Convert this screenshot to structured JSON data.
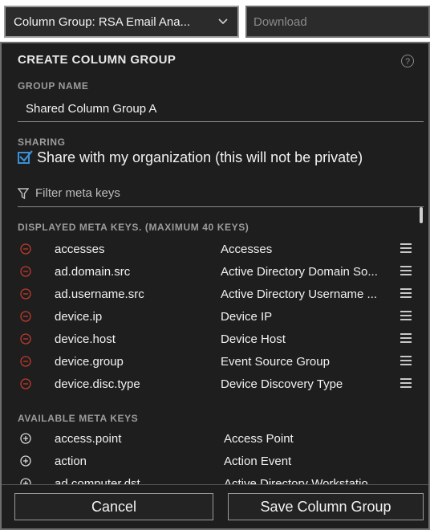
{
  "topbar": {
    "column_group_label": "Column Group: RSA Email Ana...",
    "download_placeholder": "Download"
  },
  "panel": {
    "title": "CREATE COLUMN GROUP",
    "help_icon": "question-circle-icon",
    "group_name_label": "GROUP NAME",
    "group_name_value": "Shared Column Group A",
    "sharing_label": "SHARING",
    "share_checkbox_label": "Share with my organization (this will not be private)",
    "share_checked": true,
    "filter_placeholder": "Filter meta keys",
    "displayed_label": "DISPLAYED META KEYS. (MAXIMUM 40 KEYS)",
    "displayed_keys": [
      {
        "key": "accesses",
        "label": "Accesses"
      },
      {
        "key": "ad.domain.src",
        "label": "Active Directory Domain So..."
      },
      {
        "key": "ad.username.src",
        "label": "Active Directory Username ..."
      },
      {
        "key": "device.ip",
        "label": "Device IP"
      },
      {
        "key": "device.host",
        "label": "Device Host"
      },
      {
        "key": "device.group",
        "label": "Event Source Group"
      },
      {
        "key": "device.disc.type",
        "label": "Device Discovery Type"
      }
    ],
    "available_label": "AVAILABLE META KEYS",
    "available_keys": [
      {
        "key": "access.point",
        "label": "Access Point"
      },
      {
        "key": "action",
        "label": "Action Event"
      },
      {
        "key": "ad.computer.dst",
        "label": "Active Directory Workstatio..."
      }
    ]
  },
  "footer": {
    "cancel_label": "Cancel",
    "save_label": "Save Column Group"
  },
  "colors": {
    "panel_bg": "#1e1e1e",
    "remove_icon": "#c0392b",
    "checkbox_accent": "#3a8fd6"
  }
}
